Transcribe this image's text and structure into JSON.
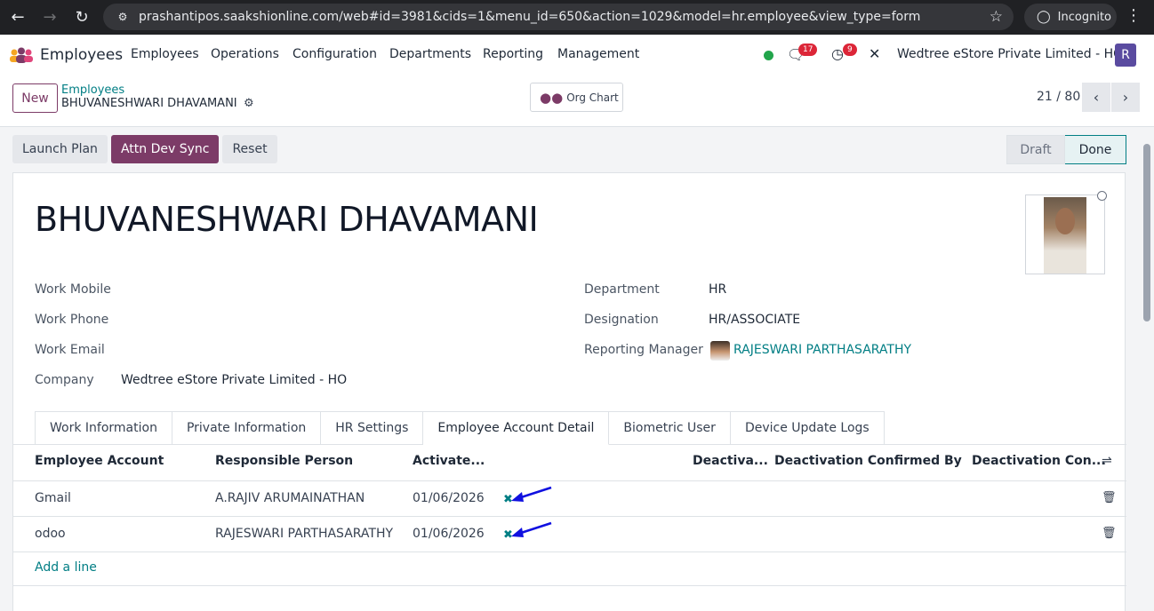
{
  "browser": {
    "url": "prashantipos.saakshionline.com/web#id=3981&cids=1&menu_id=650&action=1029&model=hr.employee&view_type=form",
    "incognito_label": "Incognito"
  },
  "navbar": {
    "app_name": "Employees",
    "menus": [
      "Employees",
      "Operations",
      "Configuration",
      "Departments",
      "Reporting",
      "Management"
    ],
    "messages_count": "17",
    "activities_count": "9",
    "company": "Wedtree eStore Private Limited - HO",
    "user_initial": "R"
  },
  "control_panel": {
    "new_label": "New",
    "breadcrumb_parent": "Employees",
    "breadcrumb_current": "BHUVANESHWARI DHAVAMANI",
    "org_chart_label": "Org Chart",
    "pager": "21 / 80"
  },
  "action_buttons": [
    "Launch Plan",
    "Attn Dev Sync",
    "Reset"
  ],
  "statusbar": {
    "draft": "Draft",
    "done": "Done"
  },
  "employee": {
    "name": "BHUVANESHWARI DHAVAMANI",
    "left_fields": [
      {
        "label": "Work Mobile",
        "value": ""
      },
      {
        "label": "Work Phone",
        "value": ""
      },
      {
        "label": "Work Email",
        "value": ""
      },
      {
        "label": "Company",
        "value": "Wedtree eStore Private Limited - HO"
      }
    ],
    "right_fields": [
      {
        "label": "Department",
        "value": "HR"
      },
      {
        "label": "Designation",
        "value": "HR/ASSOCIATE"
      },
      {
        "label": "Reporting Manager",
        "value": "RAJESWARI PARTHASARATHY"
      }
    ]
  },
  "tabs": [
    "Work Information",
    "Private Information",
    "HR Settings",
    "Employee Account Detail",
    "Biometric User",
    "Device Update Logs"
  ],
  "table": {
    "headers": [
      "Employee Account",
      "Responsible Person",
      "Activate...",
      "Deactiva...",
      "Deactivation Confirmed By",
      "Deactivation Con..."
    ],
    "rows": [
      {
        "account": "Gmail",
        "responsible": "A.RAJIV ARUMAINATHAN",
        "activate": "01/06/2026"
      },
      {
        "account": "odoo",
        "responsible": "RAJESWARI PARTHASARATHY",
        "activate": "01/06/2026"
      }
    ],
    "add_line": "Add a line"
  },
  "colors": {
    "brand": "#7c3b67",
    "link": "#017e84",
    "annotation_arrow": "#1010e0"
  }
}
